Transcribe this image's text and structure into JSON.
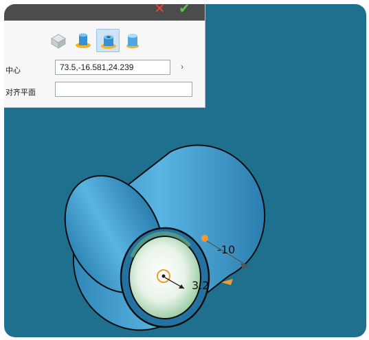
{
  "panel": {
    "labels": {
      "center": "中心",
      "align_plane": "对齐平面"
    },
    "center_value": "73.5,-16.581,24.239",
    "align_plane_value": "",
    "expand_symbol": "›",
    "tools": [
      "box-icon",
      "cylinder-icon",
      "hollow-cylinder-icon",
      "shaded-cylinder-icon"
    ],
    "active_tool": 2
  },
  "viewport": {
    "background_color": "#1f6f8f",
    "dimensions": {
      "offset": "-10",
      "thickness": "3.2"
    },
    "handle_color": "#f39a2e"
  }
}
